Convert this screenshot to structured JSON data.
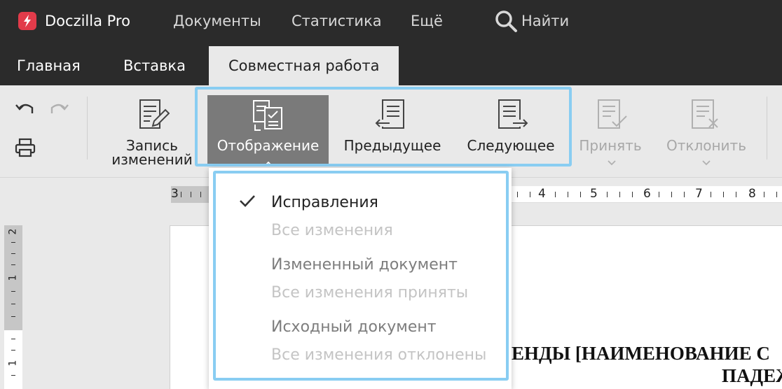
{
  "app": {
    "name": "Doczilla Pro"
  },
  "menu": {
    "items": [
      "Документы",
      "Статистика",
      "Ещё"
    ],
    "search_label": "Найти"
  },
  "tabs": [
    {
      "label": "Главная",
      "active": false
    },
    {
      "label": "Вставка",
      "active": false
    },
    {
      "label": "Совместная работа",
      "active": true
    }
  ],
  "toolbar": {
    "track_changes": {
      "line1": "Запись",
      "line2": "изменений"
    },
    "view": "Отображение",
    "previous": "Предыдущее",
    "next": "Следующее",
    "accept": "Принять",
    "reject": "Отклонить"
  },
  "dropdown": {
    "items": [
      {
        "title": "Исправления",
        "subtitle": "Все изменения",
        "checked": true
      },
      {
        "title": "Измененный документ",
        "subtitle": "Все изменения приняты",
        "checked": false
      },
      {
        "title": "Исходный документ",
        "subtitle": "Все изменения отклонены",
        "checked": false
      }
    ]
  },
  "ruler": {
    "horizontal": [
      "3",
      "4",
      "5",
      "6",
      "7",
      "8"
    ],
    "vertical": [
      "2",
      "1",
      "1"
    ]
  },
  "document": {
    "line1": "ЕНДЫ [НАИМЕНОВАНИЕ С",
    "line2": "ПАДЕЖ"
  },
  "colors": {
    "topbar": "#2b2b2b",
    "toolbar": "#e9e9e9",
    "highlight": "#89cdf2",
    "active_button": "#7a7a7a",
    "logo": "#e23b4a"
  }
}
